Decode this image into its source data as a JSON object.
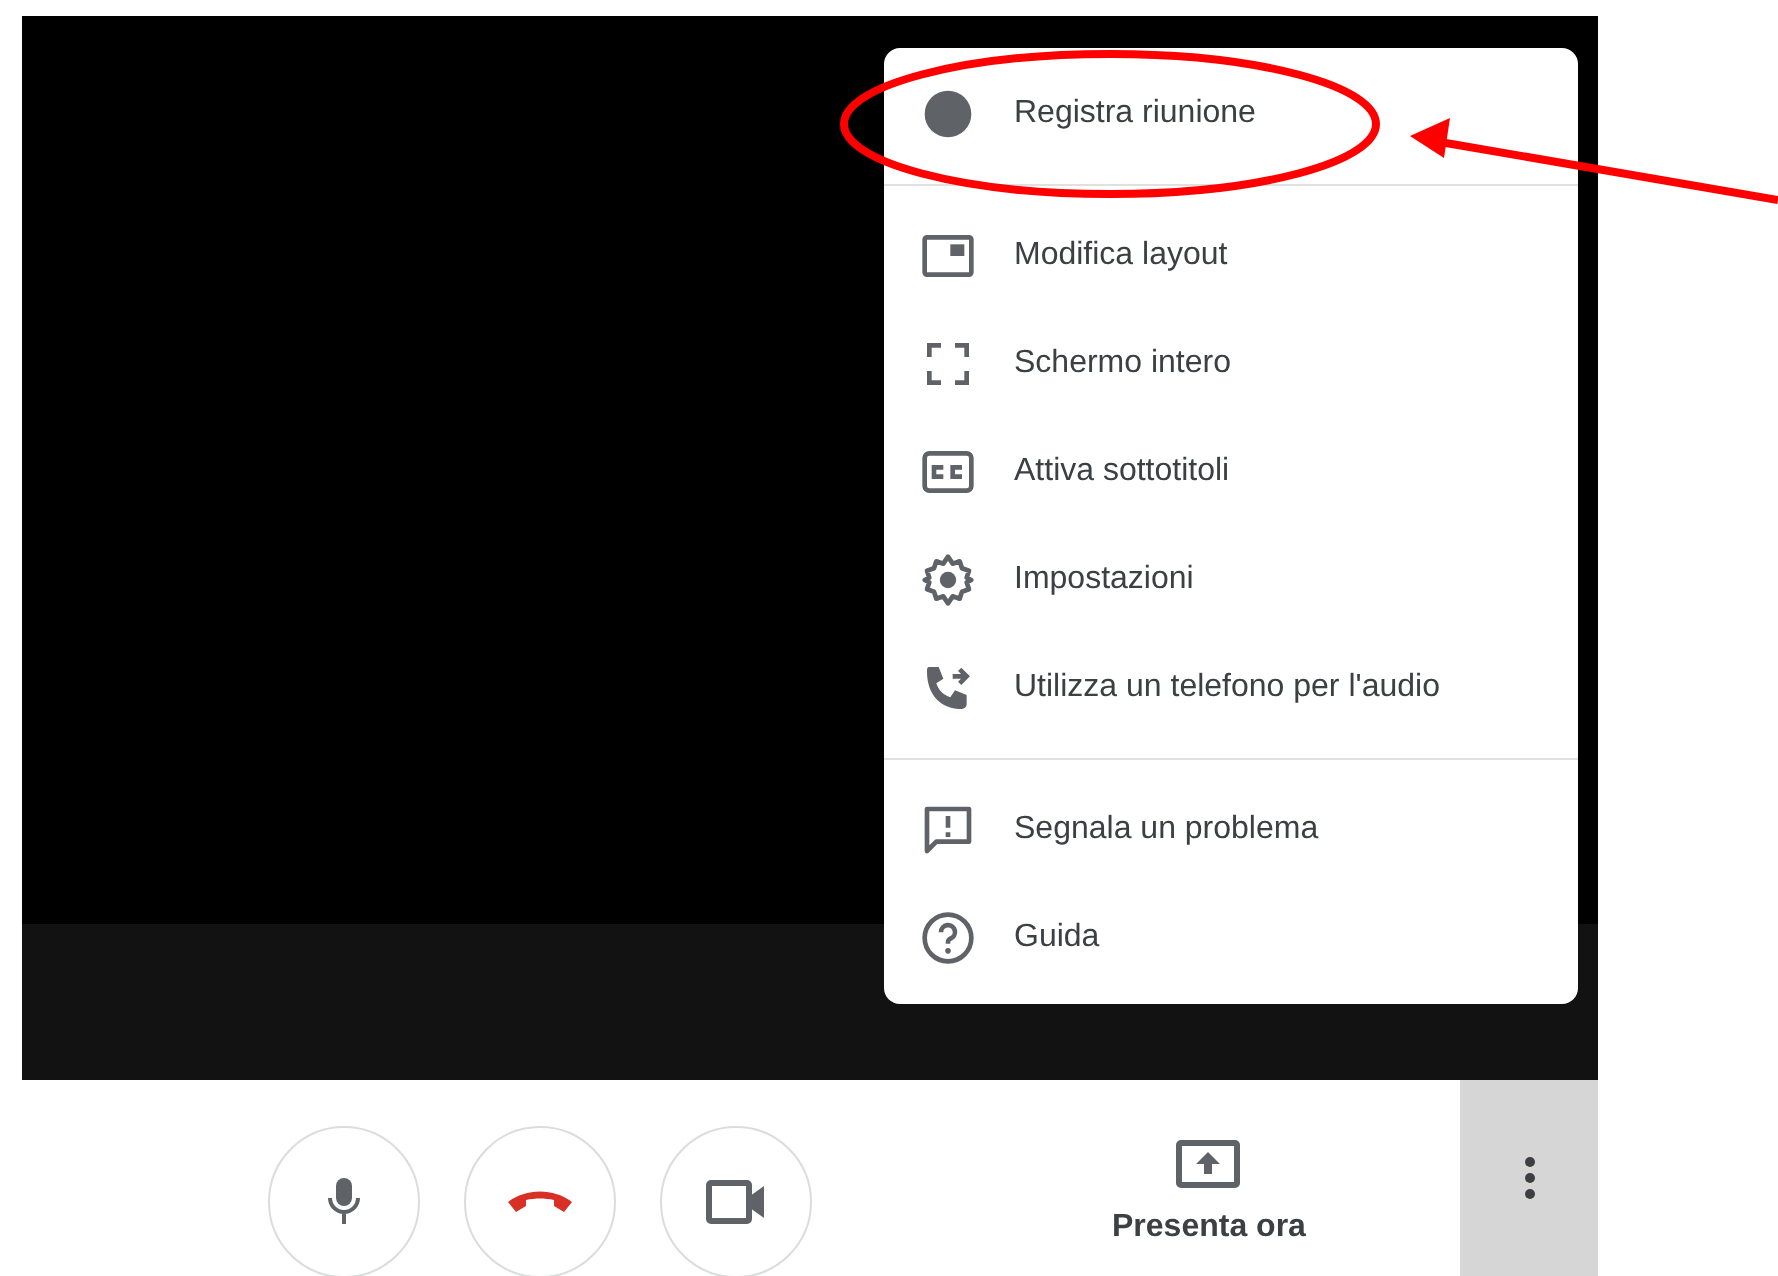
{
  "menu": {
    "sections": [
      [
        {
          "kind": "record",
          "label": "Registra riunione"
        }
      ],
      [
        {
          "kind": "layout",
          "label": "Modifica layout"
        },
        {
          "kind": "fullscreen",
          "label": "Schermo intero"
        },
        {
          "kind": "captions",
          "label": "Attiva sottotitoli"
        },
        {
          "kind": "settings",
          "label": "Impostazioni"
        },
        {
          "kind": "phone",
          "label": "Utilizza un telefono per l'audio"
        }
      ],
      [
        {
          "kind": "report",
          "label": "Segnala un problema"
        },
        {
          "kind": "help",
          "label": "Guida"
        }
      ]
    ]
  },
  "controls": {
    "present_label": "Presenta ora"
  }
}
